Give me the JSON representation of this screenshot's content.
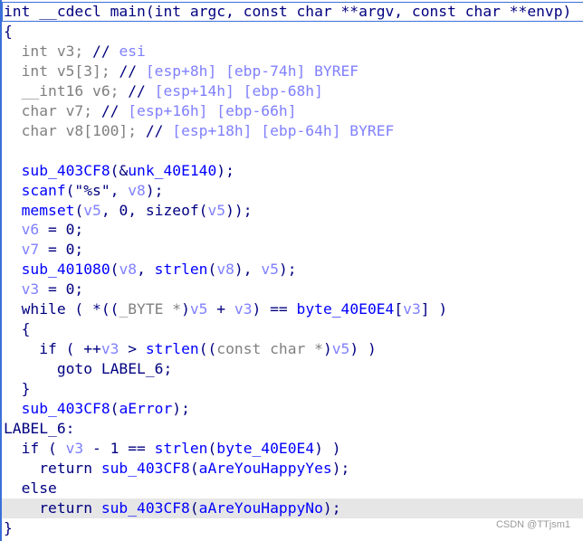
{
  "pseudocode": {
    "highlighted_line": 25,
    "cursor_line": 0,
    "lines": [
      [
        [
          "int __cdecl main(int argc, const char **argv, const char **envp)",
          "k"
        ]
      ],
      [
        [
          "{",
          "k"
        ]
      ],
      [
        [
          "  int v3; ",
          "g"
        ],
        [
          "// ",
          "k"
        ],
        [
          "esi",
          "c"
        ]
      ],
      [
        [
          "  int v5[3]; ",
          "g"
        ],
        [
          "// ",
          "k"
        ],
        [
          "[esp+8h] [ebp-74h] BYREF",
          "c"
        ]
      ],
      [
        [
          "  __int16 v6; ",
          "g"
        ],
        [
          "// ",
          "k"
        ],
        [
          "[esp+14h] [ebp-68h]",
          "c"
        ]
      ],
      [
        [
          "  char v7; ",
          "g"
        ],
        [
          "// ",
          "k"
        ],
        [
          "[esp+16h] [ebp-66h]",
          "c"
        ]
      ],
      [
        [
          "  char v8[100]; ",
          "g"
        ],
        [
          "// ",
          "k"
        ],
        [
          "[esp+18h] [ebp-64h] BYREF",
          "c"
        ]
      ],
      [
        [
          "",
          "k"
        ]
      ],
      [
        [
          "  ",
          "k"
        ],
        [
          "sub_403CF8",
          "f"
        ],
        [
          "(&",
          "k"
        ],
        [
          "unk_40E140",
          "f"
        ],
        [
          ");",
          "k"
        ]
      ],
      [
        [
          "  ",
          "k"
        ],
        [
          "scanf",
          "f"
        ],
        [
          "(\"%s\", ",
          "k"
        ],
        [
          "v8",
          "v"
        ],
        [
          ");",
          "k"
        ]
      ],
      [
        [
          "  ",
          "k"
        ],
        [
          "memset",
          "f"
        ],
        [
          "(",
          "k"
        ],
        [
          "v5",
          "v"
        ],
        [
          ", 0, sizeof(",
          "k"
        ],
        [
          "v5",
          "v"
        ],
        [
          "));",
          "k"
        ]
      ],
      [
        [
          "  ",
          "k"
        ],
        [
          "v6",
          "v"
        ],
        [
          " = 0;",
          "k"
        ]
      ],
      [
        [
          "  ",
          "k"
        ],
        [
          "v7",
          "v"
        ],
        [
          " = 0;",
          "k"
        ]
      ],
      [
        [
          "  ",
          "k"
        ],
        [
          "sub_401080",
          "f"
        ],
        [
          "(",
          "k"
        ],
        [
          "v8",
          "v"
        ],
        [
          ", ",
          "k"
        ],
        [
          "strlen",
          "f"
        ],
        [
          "(",
          "k"
        ],
        [
          "v8",
          "v"
        ],
        [
          "), ",
          "k"
        ],
        [
          "v5",
          "v"
        ],
        [
          ");",
          "k"
        ]
      ],
      [
        [
          "  ",
          "k"
        ],
        [
          "v3",
          "v"
        ],
        [
          " = 0;",
          "k"
        ]
      ],
      [
        [
          "  while ( *((",
          "k"
        ],
        [
          "_BYTE *",
          "g"
        ],
        [
          ")",
          "k"
        ],
        [
          "v5",
          "v"
        ],
        [
          " + ",
          "k"
        ],
        [
          "v3",
          "v"
        ],
        [
          ") == ",
          "k"
        ],
        [
          "byte_40E0E4",
          "f"
        ],
        [
          "[",
          "k"
        ],
        [
          "v3",
          "v"
        ],
        [
          "] )",
          "k"
        ]
      ],
      [
        [
          "  {",
          "k"
        ]
      ],
      [
        [
          "    if ( ++",
          "k"
        ],
        [
          "v3",
          "v"
        ],
        [
          " > ",
          "k"
        ],
        [
          "strlen",
          "f"
        ],
        [
          "((",
          "k"
        ],
        [
          "const char *",
          "g"
        ],
        [
          ")",
          "k"
        ],
        [
          "v5",
          "v"
        ],
        [
          ") )",
          "k"
        ]
      ],
      [
        [
          "      goto LABEL_6;",
          "k"
        ]
      ],
      [
        [
          "  }",
          "k"
        ]
      ],
      [
        [
          "  ",
          "k"
        ],
        [
          "sub_403CF8",
          "f"
        ],
        [
          "(",
          "k"
        ],
        [
          "aError",
          "f"
        ],
        [
          ");",
          "k"
        ]
      ],
      [
        [
          "LABEL_6:",
          "k"
        ]
      ],
      [
        [
          "  if ( ",
          "k"
        ],
        [
          "v3",
          "v"
        ],
        [
          " - 1 == ",
          "k"
        ],
        [
          "strlen",
          "f"
        ],
        [
          "(",
          "k"
        ],
        [
          "byte_40E0E4",
          "f"
        ],
        [
          ") )",
          "k"
        ]
      ],
      [
        [
          "    return ",
          "k"
        ],
        [
          "sub_403CF8",
          "f"
        ],
        [
          "(",
          "k"
        ],
        [
          "aAreYouHappyYes",
          "f"
        ],
        [
          ");",
          "k"
        ]
      ],
      [
        [
          "  else",
          "k"
        ]
      ],
      [
        [
          "    return ",
          "k"
        ],
        [
          "sub_403CF8",
          "f"
        ],
        [
          "(",
          "k"
        ],
        [
          "aAreYouHappyNo",
          "f"
        ],
        [
          ");",
          "k"
        ]
      ],
      [
        [
          "}",
          "k"
        ]
      ]
    ]
  },
  "watermark": "CSDN @TTjsm1"
}
